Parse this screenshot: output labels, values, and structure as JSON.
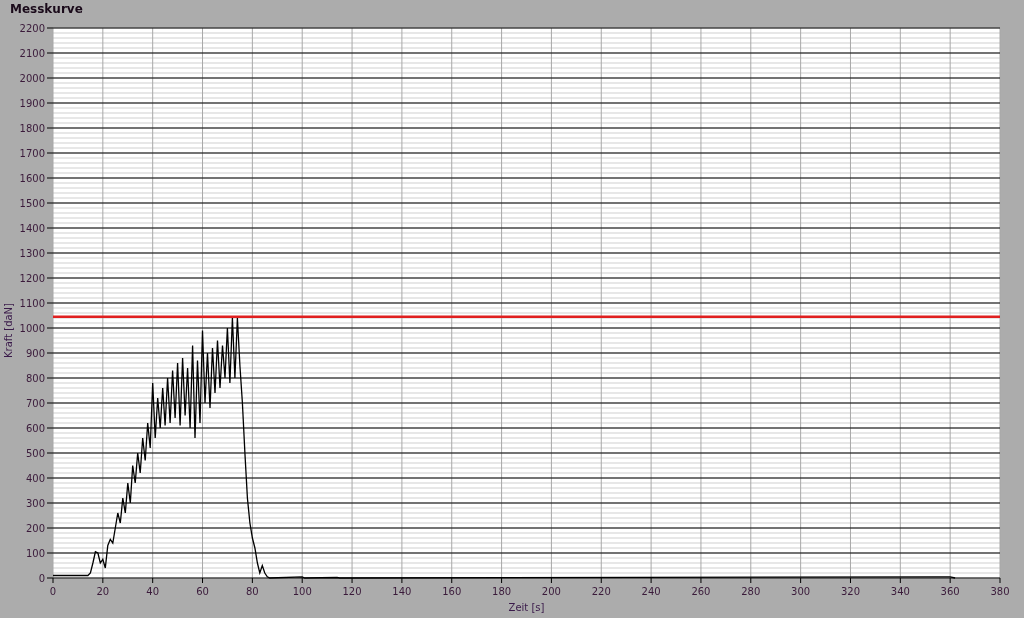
{
  "chart_data": {
    "type": "line",
    "title": "Messkurve",
    "xlabel": "Zeit [s]",
    "ylabel": "Kraft [daN]",
    "xlim": [
      0,
      380
    ],
    "ylim": [
      0,
      2200
    ],
    "xticks": [
      0,
      20,
      40,
      60,
      80,
      100,
      120,
      140,
      160,
      180,
      200,
      220,
      240,
      260,
      280,
      300,
      320,
      340,
      360,
      380
    ],
    "yticks": [
      0,
      100,
      200,
      300,
      400,
      500,
      600,
      700,
      800,
      900,
      1000,
      1100,
      1200,
      1300,
      1400,
      1500,
      1600,
      1700,
      1800,
      1900,
      2000,
      2100,
      2200
    ],
    "x": [
      0,
      14,
      15,
      16,
      17,
      18,
      19,
      20,
      21,
      22,
      23,
      24,
      25,
      26,
      27,
      28,
      29,
      30,
      31,
      32,
      33,
      34,
      35,
      36,
      37,
      38,
      39,
      40,
      41,
      42,
      43,
      44,
      45,
      46,
      47,
      48,
      49,
      50,
      51,
      52,
      53,
      54,
      55,
      56,
      57,
      58,
      59,
      60,
      61,
      62,
      63,
      64,
      65,
      66,
      67,
      68,
      69,
      70,
      71,
      72,
      73,
      74,
      75,
      76,
      77,
      78,
      79,
      80,
      81,
      82,
      83,
      84,
      85,
      86,
      87,
      100,
      101,
      114,
      115,
      355,
      360,
      362
    ],
    "series": [
      {
        "color": "#000000",
        "values": [
          10,
          10,
          20,
          60,
          105,
          100,
          60,
          75,
          40,
          130,
          155,
          140,
          200,
          260,
          220,
          320,
          260,
          380,
          300,
          450,
          380,
          500,
          420,
          560,
          470,
          620,
          520,
          780,
          560,
          720,
          600,
          760,
          610,
          800,
          620,
          830,
          640,
          860,
          610,
          880,
          650,
          840,
          600,
          930,
          560,
          870,
          620,
          990,
          700,
          900,
          680,
          920,
          740,
          950,
          760,
          930,
          800,
          1000,
          780,
          1040,
          800,
          1040,
          850,
          700,
          500,
          320,
          220,
          160,
          120,
          60,
          20,
          50,
          20,
          5,
          0,
          5,
          0,
          2,
          0,
          5,
          5,
          0
        ]
      }
    ],
    "grid": true,
    "ref_lines": [
      {
        "axis": "y",
        "value": 1045,
        "color": "#e02020"
      }
    ]
  }
}
